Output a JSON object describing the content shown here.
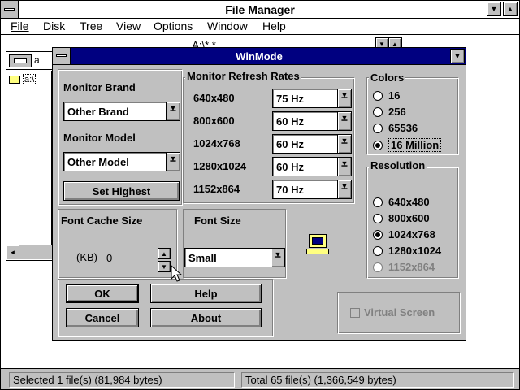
{
  "file_manager": {
    "title": "File Manager",
    "menu": [
      "File",
      "Disk",
      "Tree",
      "View",
      "Options",
      "Window",
      "Help"
    ],
    "child_title": "A:\\*.*",
    "drive_label": "a",
    "tree_root": "a:\\",
    "status_left": "Selected 1 file(s) (81,984 bytes)",
    "status_right": "Total 65 file(s) (1,366,549 bytes)"
  },
  "winmode": {
    "title": "WinMode",
    "monitor_brand": {
      "label": "Monitor Brand",
      "value": "Other Brand"
    },
    "monitor_model": {
      "label": "Monitor Model",
      "value": "Other Model"
    },
    "set_highest_label": "Set Highest",
    "refresh": {
      "label": "Monitor Refresh Rates",
      "rows": [
        {
          "res": "640x480",
          "rate": "75 Hz"
        },
        {
          "res": "800x600",
          "rate": "60 Hz"
        },
        {
          "res": "1024x768",
          "rate": "60 Hz"
        },
        {
          "res": "1280x1024",
          "rate": "60 Hz"
        },
        {
          "res": "1152x864",
          "rate": "70 Hz"
        }
      ]
    },
    "colors": {
      "label": "Colors",
      "options": [
        {
          "label": "16",
          "checked": false
        },
        {
          "label": "256",
          "checked": false
        },
        {
          "label": "65536",
          "checked": false
        },
        {
          "label": "16 Million",
          "checked": true
        }
      ]
    },
    "resolution": {
      "label": "Resolution",
      "options": [
        {
          "label": "640x480",
          "checked": false,
          "disabled": false
        },
        {
          "label": "800x600",
          "checked": false,
          "disabled": false
        },
        {
          "label": "1024x768",
          "checked": true,
          "disabled": false
        },
        {
          "label": "1280x1024",
          "checked": false,
          "disabled": false
        },
        {
          "label": "1152x864",
          "checked": false,
          "disabled": true
        }
      ]
    },
    "font_cache": {
      "label": "Font Cache Size",
      "unit": "(KB)",
      "value": "0"
    },
    "font_size": {
      "label": "Font Size",
      "value": "Small"
    },
    "ok_label": "OK",
    "help_label": "Help",
    "cancel_label": "Cancel",
    "about_label": "About",
    "virtual_screen_label": "Virtual Screen"
  },
  "colors": {
    "titlebar": "#000080",
    "face": "#c0c0c0",
    "shadow": "#808080",
    "disabled_text": "#808080"
  }
}
